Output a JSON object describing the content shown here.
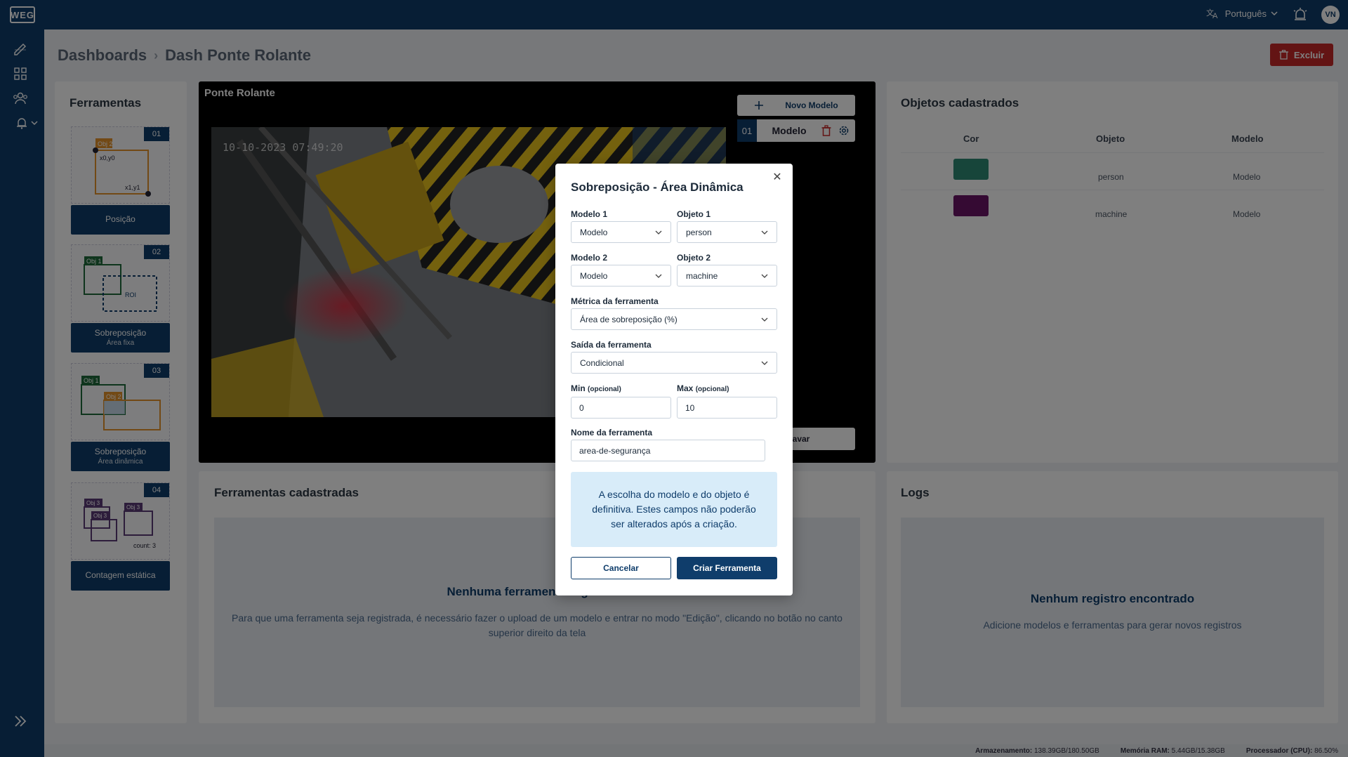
{
  "topbar": {
    "logo": "WEG",
    "language": "Português",
    "avatar": "VN"
  },
  "breadcrumb": {
    "root": "Dashboards",
    "current": "Dash Ponte Rolante"
  },
  "header": {
    "delete_label": "Excluir"
  },
  "tools": {
    "title": "Ferramentas",
    "items": [
      {
        "num": "01",
        "label": "Posição",
        "sublabel": "",
        "thumb": {
          "obj": "Obj 2",
          "p0": "x0,y0",
          "p1": "x1,y1"
        }
      },
      {
        "num": "02",
        "label": "Sobreposição",
        "sublabel": "Área fixa",
        "thumb": {
          "obj": "Obj 1",
          "roi": "ROI"
        }
      },
      {
        "num": "03",
        "label": "Sobreposição",
        "sublabel": "Área dinâmica",
        "thumb": {
          "obj1": "Obj 1",
          "obj2": "Obj 2"
        }
      },
      {
        "num": "04",
        "label": "Contagem estática",
        "sublabel": "",
        "thumb": {
          "obj_a": "Obj 3",
          "obj_b": "Obj 3",
          "obj_c": "Obj 3",
          "count": "count: 3"
        }
      }
    ]
  },
  "video": {
    "title": "Ponte Rolante",
    "timestamp": "10-10-2023 07:49:20",
    "new_model_label": "Novo Modelo",
    "model": {
      "num": "01",
      "name": "Modelo"
    },
    "record_label": "Gravar"
  },
  "objects": {
    "title": "Objetos cadastrados",
    "headers": [
      "Cor",
      "Objeto",
      "Modelo"
    ],
    "rows": [
      {
        "color": "#2e8b74",
        "object": "person",
        "model": "Modelo"
      },
      {
        "color": "#6a1566",
        "object": "machine",
        "model": "Modelo"
      }
    ]
  },
  "registered_tools": {
    "title": "Ferramentas cadastradas",
    "empty_title": "Nenhuma ferramenta registrada",
    "empty_text": "Para que uma ferramenta seja registrada, é necessário fazer o upload de um modelo e entrar no modo \"Edição\", clicando no botão no canto superior direito da tela"
  },
  "logs": {
    "title": "Logs",
    "empty_title": "Nenhum registro encontrado",
    "empty_text": "Adicione modelos e ferramentas para gerar novos registros"
  },
  "statusbar": {
    "storage_label": "Armazenamento:",
    "storage": "138.39GB/180.50GB",
    "ram_label": "Memória RAM:",
    "ram": "5.44GB/15.38GB",
    "cpu_label": "Processador (CPU):",
    "cpu": "86.50%"
  },
  "modal": {
    "title": "Sobreposição - Área Dinâmica",
    "modelo1_label": "Modelo 1",
    "modelo1_value": "Modelo",
    "objeto1_label": "Objeto 1",
    "objeto1_value": "person",
    "modelo2_label": "Modelo 2",
    "modelo2_value": "Modelo",
    "objeto2_label": "Objeto 2",
    "objeto2_value": "machine",
    "metric_label": "Métrica da ferramenta",
    "metric_value": "Área de sobreposição (%)",
    "output_label": "Saída da ferramenta",
    "output_value": "Condicional",
    "min_label": "Min",
    "min_hint": "(opcional)",
    "min_value": "0",
    "max_label": "Max",
    "max_hint": "(opcional)",
    "max_value": "10",
    "name_label": "Nome da ferramenta",
    "name_value": "area-de-segurança",
    "info": "A escolha do modelo e do objeto é definitiva. Estes campos não poderão ser alterados após a criação.",
    "cancel_label": "Cancelar",
    "create_label": "Criar Ferramenta"
  },
  "colors": {
    "primary": "#0f3d6b",
    "danger": "#c62828",
    "info_bg": "#d8ecf9"
  }
}
